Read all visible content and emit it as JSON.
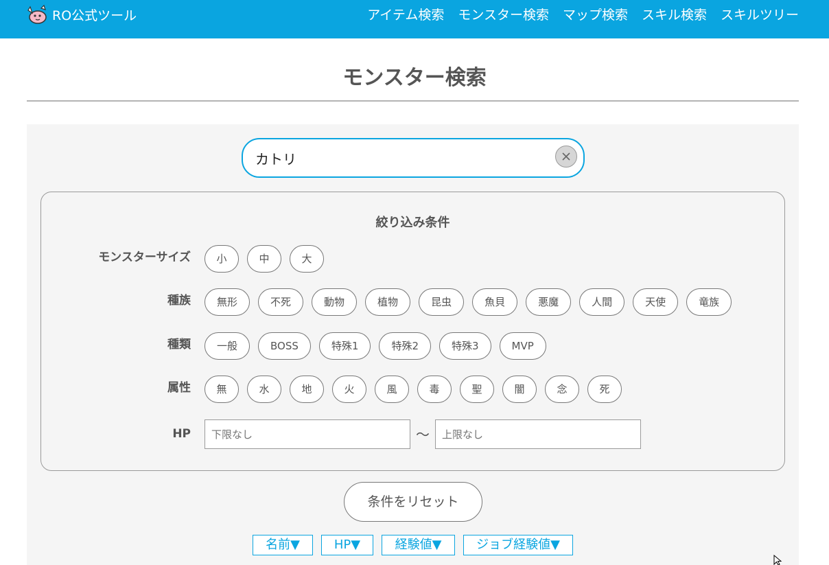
{
  "header": {
    "brand": "RO公式ツール",
    "nav": [
      "アイテム検索",
      "モンスター検索",
      "マップ検索",
      "スキル検索",
      "スキルツリー"
    ]
  },
  "page_title": "モンスター検索",
  "search": {
    "value": "カトリ"
  },
  "filters": {
    "title": "絞り込み条件",
    "size": {
      "label": "モンスターサイズ",
      "options": [
        "小",
        "中",
        "大"
      ]
    },
    "race": {
      "label": "種族",
      "options": [
        "無形",
        "不死",
        "動物",
        "植物",
        "昆虫",
        "魚貝",
        "悪魔",
        "人間",
        "天使",
        "竜族"
      ]
    },
    "type": {
      "label": "種類",
      "options": [
        "一般",
        "BOSS",
        "特殊1",
        "特殊2",
        "特殊3",
        "MVP"
      ]
    },
    "element": {
      "label": "属性",
      "options": [
        "無",
        "水",
        "地",
        "火",
        "風",
        "毒",
        "聖",
        "闇",
        "念",
        "死"
      ]
    },
    "hp": {
      "label": "HP",
      "min_placeholder": "下限なし",
      "max_placeholder": "上限なし",
      "separator": "～"
    }
  },
  "reset_label": "条件をリセット",
  "sort_buttons": [
    "名前▼",
    "HP▼",
    "経験値▼",
    "ジョブ経験値▼"
  ],
  "colors": {
    "accent": "#0aa5e0",
    "panel": "#f5f5f5",
    "text": "#555555"
  }
}
